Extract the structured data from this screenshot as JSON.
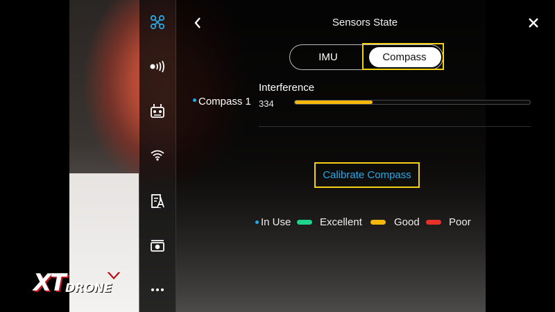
{
  "header": {
    "title": "Sensors State"
  },
  "tabs": [
    {
      "label": "IMU",
      "selected": false
    },
    {
      "label": "Compass",
      "selected": true
    }
  ],
  "sidebar": {
    "items": [
      {
        "icon": "drone-icon",
        "active": true
      },
      {
        "icon": "signal-icon",
        "active": false
      },
      {
        "icon": "remote-controller-icon",
        "active": false
      },
      {
        "icon": "wifi-icon",
        "active": false
      },
      {
        "icon": "battery-icon",
        "active": false
      },
      {
        "icon": "camera-icon",
        "active": false
      },
      {
        "icon": "more-icon",
        "active": false
      }
    ]
  },
  "compass": {
    "sensor_name": "Compass 1",
    "interference_label": "Interference",
    "interference_value": "334",
    "interference_fraction": 0.33,
    "status_color": "#f5b80c"
  },
  "actions": {
    "calibrate_label": "Calibrate Compass"
  },
  "legend": {
    "in_use": "In Use",
    "excellent": "Excellent",
    "good": "Good",
    "poor": "Poor",
    "in_use_color": "#2aa8e6",
    "excellent_color": "#20d38a",
    "good_color": "#f5b80c",
    "poor_color": "#e6322b"
  },
  "logo": {
    "text_xt": "XT",
    "text_drone": "DRONE"
  },
  "colors": {
    "accent_blue": "#2aa8e6",
    "highlight_yellow": "#f7d117"
  }
}
